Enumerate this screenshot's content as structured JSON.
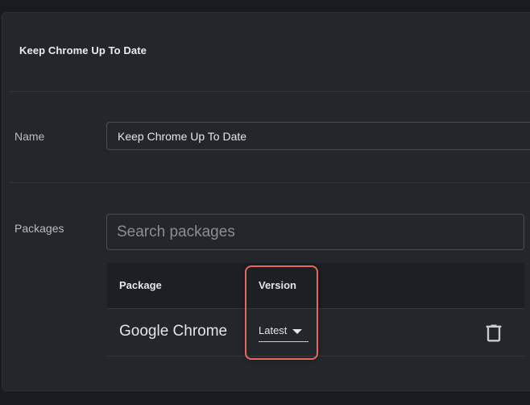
{
  "header": {
    "title": "Keep Chrome Up To Date"
  },
  "form": {
    "name_label": "Name",
    "name_value": "Keep Chrome Up To Date",
    "packages_label": "Packages",
    "search_placeholder": "Search packages"
  },
  "table": {
    "columns": [
      "Package",
      "Version"
    ],
    "rows": [
      {
        "package": "Google Chrome",
        "version": "Latest"
      }
    ]
  },
  "icons": {
    "delete": "trash-icon",
    "dropdown": "caret-down-icon"
  },
  "colors": {
    "highlight": "#e8685b",
    "panel": "#23272b",
    "background": "#181b1f"
  }
}
